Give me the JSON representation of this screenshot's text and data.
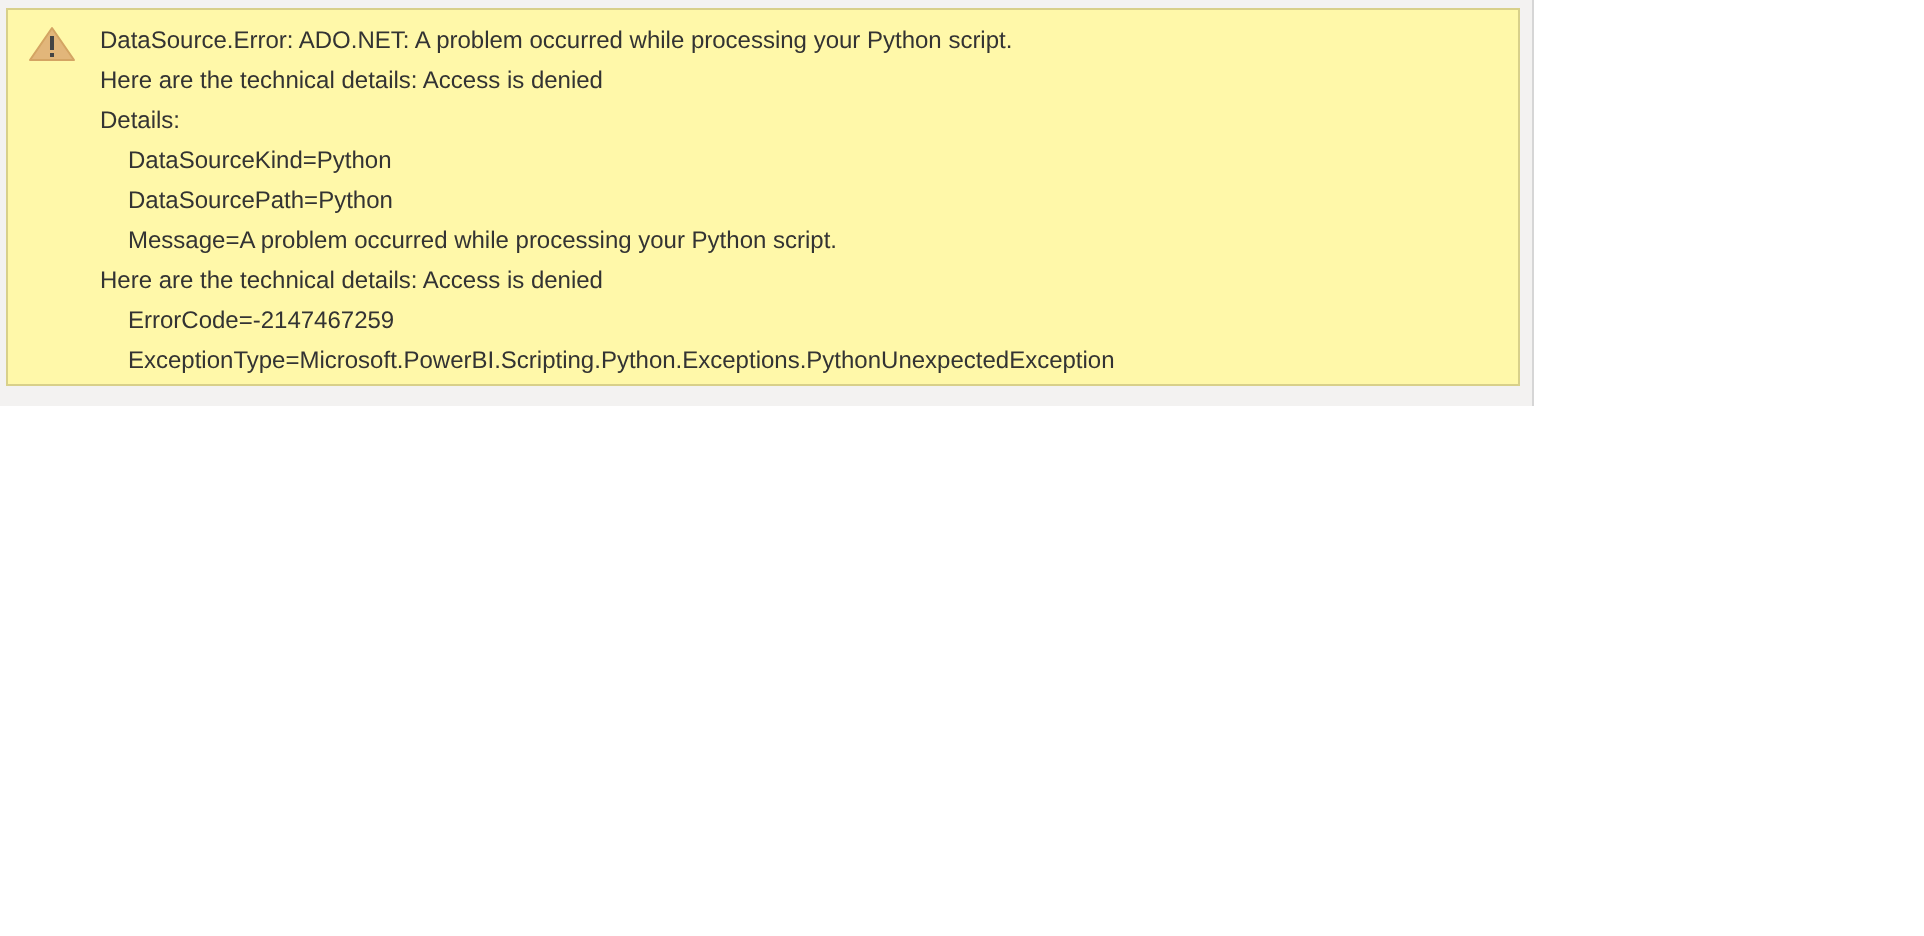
{
  "error": {
    "lines": [
      {
        "text": "DataSource.Error: ADO.NET: A problem occurred while processing your Python script."
      },
      {
        "text": "Here are the technical details: Access is denied"
      },
      {
        "text": "Details:",
        "children": [
          {
            "text": "DataSourceKind=Python"
          },
          {
            "text": "DataSourcePath=Python"
          },
          {
            "text": "Message=A problem occurred while processing your Python script."
          }
        ]
      },
      {
        "text": "Here are the technical details: Access is denied",
        "children": [
          {
            "text": "ErrorCode=-2147467259"
          },
          {
            "text": "ExceptionType=Microsoft.PowerBI.Scripting.Python.Exceptions.PythonUnexpectedException"
          }
        ]
      }
    ]
  }
}
